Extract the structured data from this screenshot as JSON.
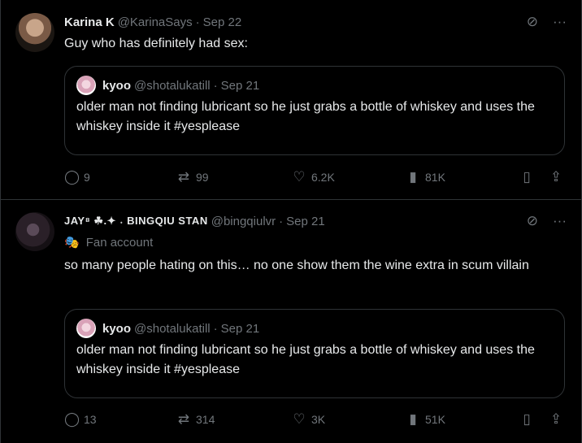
{
  "tweets": [
    {
      "display_name": "Karina K",
      "handle": "@KarinaSays",
      "date": "Sep 22",
      "text": "Guy who has definitely had sex:",
      "quote": {
        "display_name": "kyoo",
        "handle": "@shotalukatill",
        "date": "Sep 21",
        "text": "older man not finding lubricant so he just grabs a bottle of whiskey and uses the whiskey inside it #yesplease"
      },
      "stats": {
        "replies": "9",
        "reposts": "99",
        "likes": "6.2K",
        "views": "81K"
      }
    },
    {
      "display_name": "JAY⁸ ☘.✦ ˖ BINGQIU STAN",
      "handle": "@bingqiulvr",
      "date": "Sep 21",
      "badge": "Fan account",
      "text": "so many people hating on this… no one show them the wine extra in scum villain",
      "quote": {
        "display_name": "kyoo",
        "handle": "@shotalukatill",
        "date": "Sep 21",
        "text": "older man not finding lubricant so he just grabs a bottle of whiskey and uses the whiskey inside it #yesplease"
      },
      "stats": {
        "replies": "13",
        "reposts": "314",
        "likes": "3K",
        "views": "51K"
      }
    }
  ],
  "icons": {
    "grok": "⊘",
    "more": "···",
    "reply": "◯",
    "repost": "⇄",
    "like": "♡",
    "views": "▮",
    "bookmark": "▯",
    "share": "⇪",
    "mask": "🎭"
  },
  "colors": {
    "background": "#000000",
    "text": "#e7e9ea",
    "muted": "#71767b",
    "border": "#2f3336"
  }
}
